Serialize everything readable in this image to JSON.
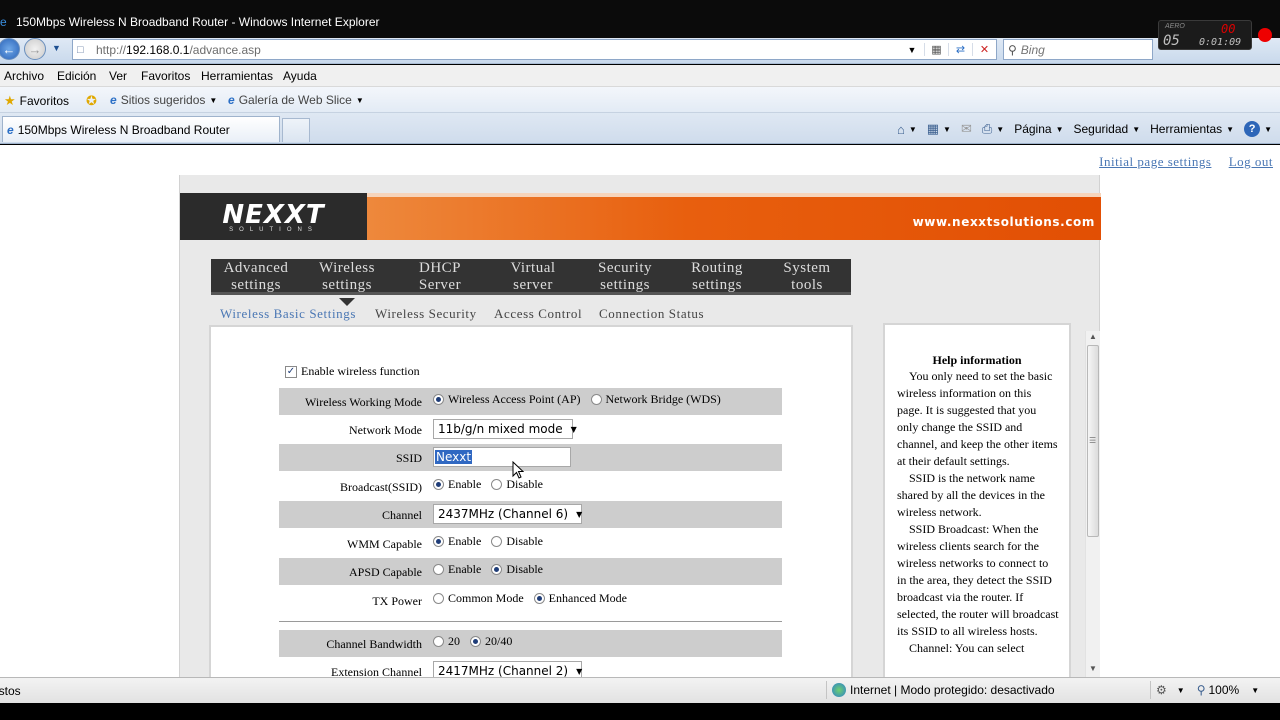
{
  "window": {
    "title": "150Mbps Wireless N Broadband Router - Windows Internet Explorer",
    "aero_widget": {
      "label": "AERO",
      "big": "05",
      "red": "00",
      "time": "0:01:09"
    }
  },
  "addressbar": {
    "url_prefix": "http://",
    "url_host": "192.168.0.1",
    "url_path": "/advance.asp",
    "search_placeholder": "Bing"
  },
  "menubar": [
    "Archivo",
    "Edición",
    "Ver",
    "Favoritos",
    "Herramientas",
    "Ayuda"
  ],
  "favorites_bar": {
    "favorites": "Favoritos",
    "suggested_sites": "Sitios sugeridos",
    "web_slice_gallery": "Galería de Web Slice"
  },
  "tab": {
    "label": "150Mbps Wireless N Broadband Router"
  },
  "command_bar": {
    "page": "Página",
    "security": "Seguridad",
    "tools": "Herramientas"
  },
  "top_links": {
    "initial_settings": "Initial page settings",
    "logout": "Log out"
  },
  "banner": {
    "logo_text": "NEXXT",
    "logo_sub": "SOLUTIONS",
    "site_url": "www.nexxtsolutions.com"
  },
  "main_nav": [
    {
      "line1": "Advanced",
      "line2": "settings"
    },
    {
      "line1": "Wireless",
      "line2": "settings",
      "active": true
    },
    {
      "line1": "DHCP",
      "line2": "Server"
    },
    {
      "line1": "Virtual",
      "line2": "server"
    },
    {
      "line1": "Security",
      "line2": "settings"
    },
    {
      "line1": "Routing",
      "line2": "settings"
    },
    {
      "line1": "System",
      "line2": "tools"
    }
  ],
  "sub_nav": [
    "Wireless Basic Settings",
    "Wireless Security",
    "Access Control",
    "Connection Status"
  ],
  "form": {
    "enable_wireless": "Enable wireless function",
    "working_mode": {
      "label": "Wireless Working Mode",
      "opt_ap": "Wireless Access Point (AP)",
      "opt_wds": "Network Bridge (WDS)"
    },
    "network_mode": {
      "label": "Network Mode",
      "value": "11b/g/n mixed mode"
    },
    "ssid": {
      "label": "SSID",
      "value": "Nexxt"
    },
    "broadcast": {
      "label": "Broadcast(SSID)",
      "enable": "Enable",
      "disable": "Disable"
    },
    "channel": {
      "label": "Channel",
      "value": "2437MHz (Channel 6)"
    },
    "wmm": {
      "label": "WMM Capable",
      "enable": "Enable",
      "disable": "Disable"
    },
    "apsd": {
      "label": "APSD Capable",
      "enable": "Enable",
      "disable": "Disable"
    },
    "tx_power": {
      "label": "TX Power",
      "common": "Common Mode",
      "enhanced": "Enhanced Mode"
    },
    "bandwidth": {
      "label": "Channel Bandwidth",
      "opt_20": "20",
      "opt_2040": "20/40"
    },
    "ext_channel": {
      "label": "Extension Channel",
      "value": "2417MHz (Channel 2)"
    }
  },
  "help": {
    "title": "Help information",
    "paragraphs": [
      "You only need to set the basic wireless information on this page. It is suggested that you only change the SSID and channel, and keep the other items at their default settings.",
      "SSID is the network name shared by all the devices in the wireless network.",
      "SSID Broadcast: When the wireless clients search for the wireless networks to connect to in the area, they detect the SSID broadcast via the router. If selected, the router will broadcast its SSID to all wireless hosts.",
      "Channel: You can select"
    ]
  },
  "statusbar": {
    "left": "istos",
    "zone": "Internet | Modo protegido: desactivado",
    "zoom": "100%"
  }
}
